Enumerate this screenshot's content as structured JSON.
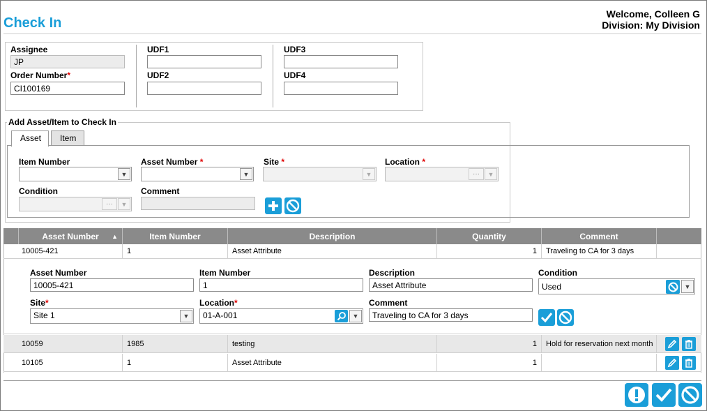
{
  "header": {
    "title": "Check In",
    "welcome": "Welcome, Colleen G",
    "division": "Division: My Division"
  },
  "form": {
    "assignee_label": "Assignee",
    "assignee_value": "JP",
    "order_label": "Order Number",
    "order_value": "CI100169",
    "udf1_label": "UDF1",
    "udf1_value": "",
    "udf2_label": "UDF2",
    "udf2_value": "",
    "udf3_label": "UDF3",
    "udf3_value": "",
    "udf4_label": "UDF4",
    "udf4_value": "",
    "required_mark": "*"
  },
  "add_section": {
    "legend": "Add Asset/Item to Check In",
    "tabs": [
      "Asset",
      "Item"
    ],
    "item_number_label": "Item Number",
    "asset_number_label": "Asset Number",
    "site_label": "Site",
    "location_label": "Location",
    "condition_label": "Condition",
    "comment_label": "Comment",
    "ellipsis": "···"
  },
  "grid": {
    "columns": [
      "Asset Number",
      "Item Number",
      "Description",
      "Quantity",
      "Comment"
    ],
    "sort_indicator": "▲",
    "rows": [
      {
        "asset": "10005-421",
        "item": "1",
        "description": "Asset Attribute",
        "quantity": "1",
        "comment": "Traveling to CA for 3 days"
      },
      {
        "asset": "10059",
        "item": "1985",
        "description": "testing",
        "quantity": "1",
        "comment": "Hold for reservation next month"
      },
      {
        "asset": "10105",
        "item": "1",
        "description": "Asset Attribute",
        "quantity": "1",
        "comment": ""
      }
    ]
  },
  "edit_row": {
    "asset_number_label": "Asset Number",
    "asset_number_value": "10005-421",
    "item_number_label": "Item Number",
    "item_number_value": "1",
    "description_label": "Description",
    "description_value": "Asset Attribute",
    "condition_label": "Condition",
    "condition_value": "Used",
    "site_label": "Site",
    "site_value": "Site 1",
    "location_label": "Location",
    "location_value": "01-A-001",
    "comment_label": "Comment",
    "comment_value": "Traveling to CA for 3 days"
  },
  "colors": {
    "accent": "#1a9ed8",
    "header_gray": "#8a8a8a",
    "required": "#e00000"
  },
  "icons": [
    "plus-icon",
    "cancel-icon",
    "check-icon",
    "search-icon",
    "edit-icon",
    "trash-icon",
    "alert-icon",
    "chevron-down-icon"
  ]
}
